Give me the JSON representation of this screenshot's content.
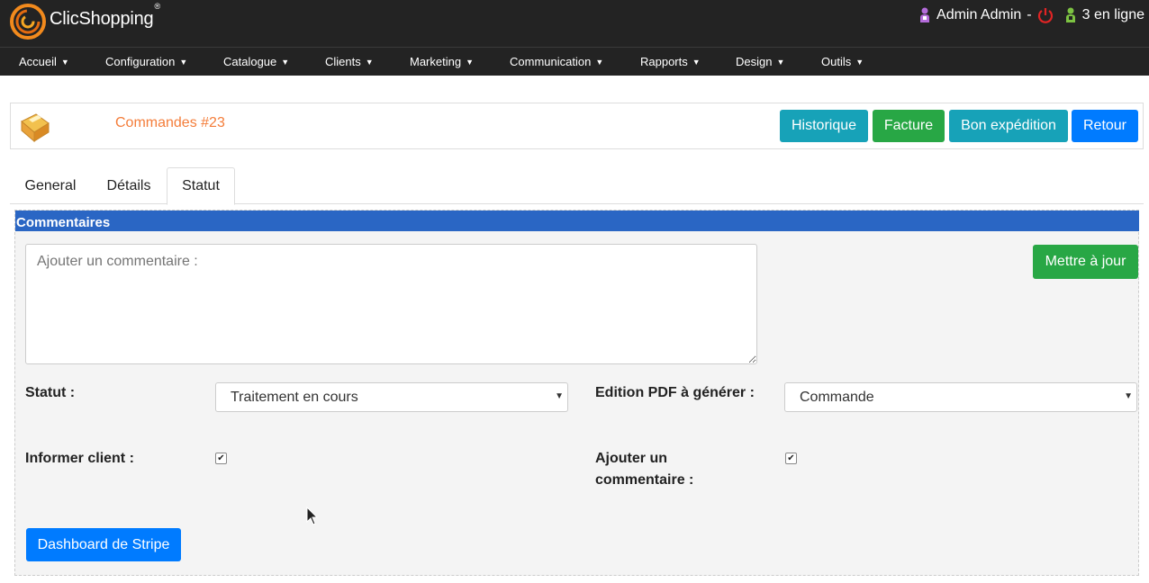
{
  "app": {
    "brand": "ClicShopping",
    "brand_mark": "®"
  },
  "user": {
    "name": "Admin Admin",
    "separator": "-",
    "online": "3 en ligne"
  },
  "nav": [
    {
      "label": "Accueil"
    },
    {
      "label": "Configuration"
    },
    {
      "label": "Catalogue"
    },
    {
      "label": "Clients"
    },
    {
      "label": "Marketing"
    },
    {
      "label": "Communication"
    },
    {
      "label": "Rapports"
    },
    {
      "label": "Design"
    },
    {
      "label": "Outils"
    }
  ],
  "header": {
    "title": "Commandes #23",
    "buttons": {
      "history": "Historique",
      "invoice": "Facture",
      "shipping": "Bon expédition",
      "back": "Retour"
    }
  },
  "tabs": {
    "general": "General",
    "details": "Détails",
    "status": "Statut",
    "active": "Statut"
  },
  "section": {
    "title": "Commentaires",
    "comment_placeholder": "Ajouter un commentaire :",
    "update_button": "Mettre à jour",
    "status_label": "Statut :",
    "status_value": "Traitement en cours",
    "pdf_label": "Edition PDF à générer :",
    "pdf_value": "Commande",
    "notify_label": "Informer client :",
    "notify_checked": true,
    "add_comment_label": "Ajouter un commentaire :",
    "add_comment_checked": true,
    "stripe_button": "Dashboard de Stripe"
  },
  "colors": {
    "topbar": "#232323",
    "section_bar": "#2a66c4",
    "title": "#f47d3a",
    "teal": "#17a2b8",
    "green": "#28a745",
    "blue": "#007bff"
  }
}
